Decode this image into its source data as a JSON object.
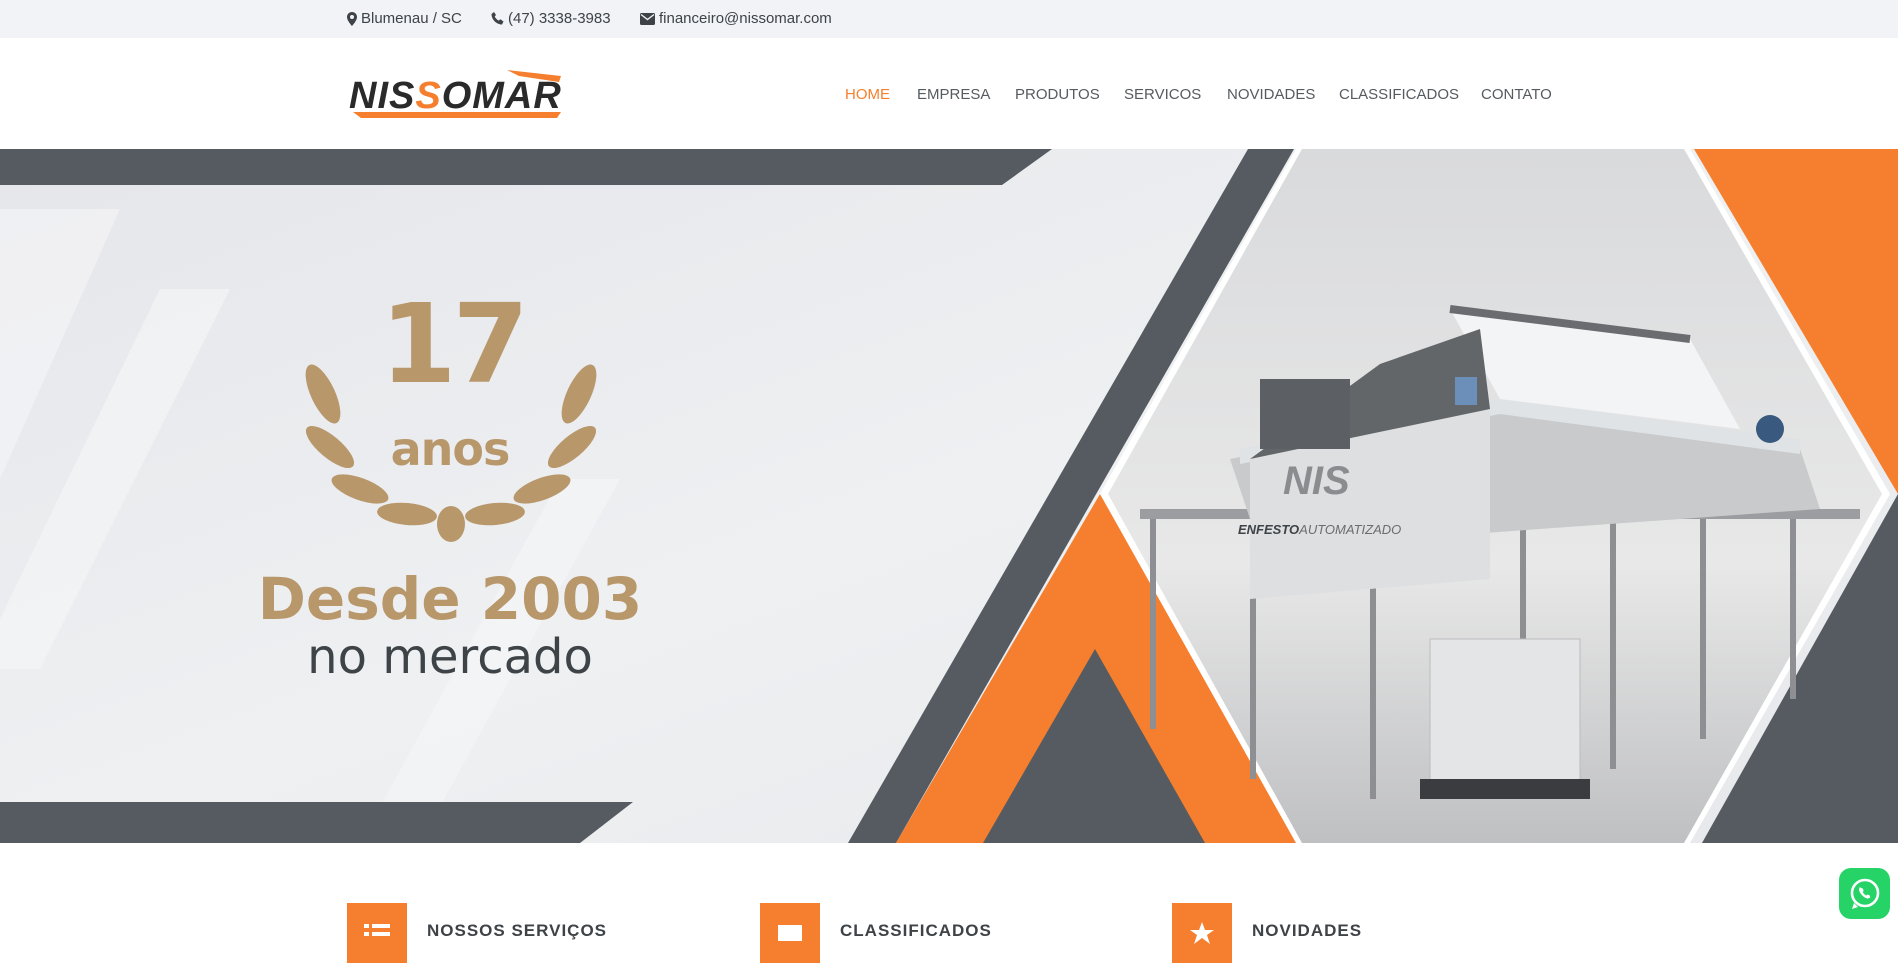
{
  "topbar": {
    "location": "Blumenau / SC",
    "phone": "(47) 3338-3983",
    "email": "financeiro@nissomar.com"
  },
  "brand": {
    "logo_text": "NISSOMAR"
  },
  "nav": {
    "items": [
      {
        "label": "HOME",
        "active": true
      },
      {
        "label": "EMPRESA",
        "active": false
      },
      {
        "label": "PRODUTOS",
        "active": false
      },
      {
        "label": "SERVICOS",
        "active": false
      },
      {
        "label": "NOVIDADES",
        "active": false
      },
      {
        "label": "CLASSIFICADOS",
        "active": false
      },
      {
        "label": "CONTATO",
        "active": false
      }
    ]
  },
  "hero": {
    "years": "17",
    "years_label": "anos",
    "since": "Desde 2003",
    "market": "no mercado",
    "machine_brand": "NIS",
    "machine_caption_bold": "ENFESTO",
    "machine_caption_light": "AUTOMATIZADO"
  },
  "features": [
    {
      "title": "NOSSOS SERVIÇOS",
      "icon": "list-icon"
    },
    {
      "title": "CLASSIFICADOS",
      "icon": "tag-icon"
    },
    {
      "title": "NOVIDADES",
      "icon": "star-icon"
    }
  ],
  "colors": {
    "accent": "#f57f2e",
    "dark": "#555b60",
    "gold": "#b8976a",
    "topbar_bg": "#f1f3f6",
    "whatsapp": "#25d366"
  }
}
